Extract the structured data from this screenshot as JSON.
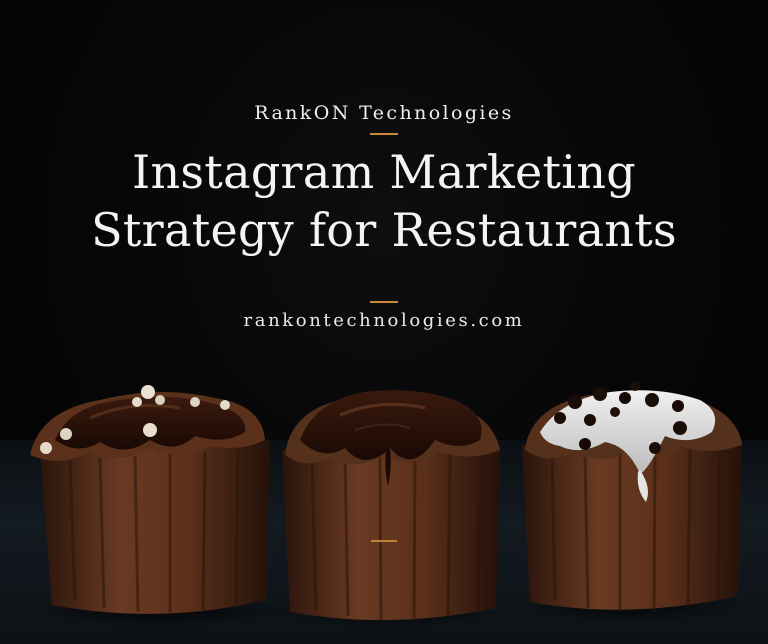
{
  "poster": {
    "brand": "RankON Technologies",
    "headline_line1": "Instagram Marketing",
    "headline_line2": "Strategy for Restaurants",
    "website": "rankontechnologies.com"
  },
  "colors": {
    "background": "#050505",
    "accent_rule": "#c98b3c",
    "text": "#f4f4f4"
  }
}
